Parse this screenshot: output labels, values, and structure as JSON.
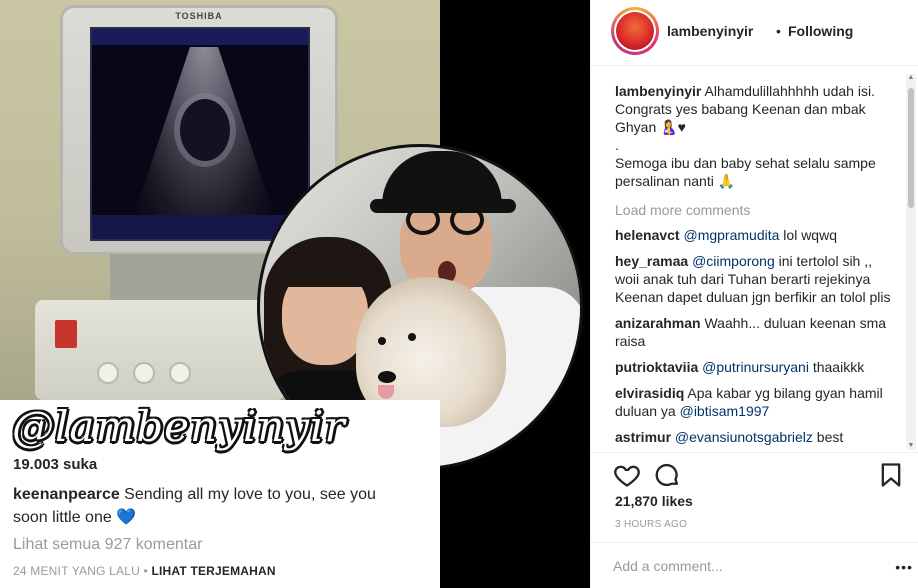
{
  "post_image": {
    "monitor_brand": "TOSHIBA",
    "watermark": "@lambenyinyir",
    "card_likes": "19.003 suka",
    "card_caption_user": "keenanpearce",
    "card_caption_text": " Sending all my love to you, see you soon little one ",
    "card_view_all": "Lihat semua 927 komentar",
    "card_time": "24 MENIT YANG LALU",
    "card_separator": " • ",
    "card_translate": "LIHAT TERJEMAHAN"
  },
  "header": {
    "username": "lambenyinyir",
    "separator": "•",
    "follow_state": "Following"
  },
  "caption": {
    "user": "lambenyinyir",
    "text": "Alhamdulillahhhhh udah isi. Congrats yes babang Keenan dan mbak Ghyan 🤱♥\n.\nSemoga ibu dan baby sehat selalu sampe persalinan nanti 🙏"
  },
  "load_more": "Load more comments",
  "comments": [
    {
      "user": "helenavct",
      "mention": "@mgpramudita",
      "text": " lol wqwq"
    },
    {
      "user": "hey_ramaa",
      "mention": "@ciimporong",
      "text": " ini tertolol sih ,, woii anak tuh dari Tuhan berarti rejekinya Keenan dapet duluan jgn berfikir an tolol plis"
    },
    {
      "user": "anizarahman",
      "mention": "",
      "text": "Waahh... duluan keenan sma raisa"
    },
    {
      "user": "putrioktaviia",
      "mention": "@putrinursuryani",
      "text": " thaaikkk"
    },
    {
      "user": "elvirasidiq",
      "mention": "",
      "text": "Apa kabar yg bilang gyan hamil duluan ya ",
      "mention_after": "@ibtisam1997"
    },
    {
      "user": "astrimur",
      "mention": "@evansiunotsgabrielz",
      "text": " best"
    }
  ],
  "actions": {
    "like_icon": "heart-icon",
    "comment_icon": "comment-icon",
    "save_icon": "bookmark-icon"
  },
  "likes": "21,870 likes",
  "timestamp": "3 HOURS AGO",
  "add_comment": {
    "placeholder": "Add a comment..."
  },
  "more_label": "•••"
}
